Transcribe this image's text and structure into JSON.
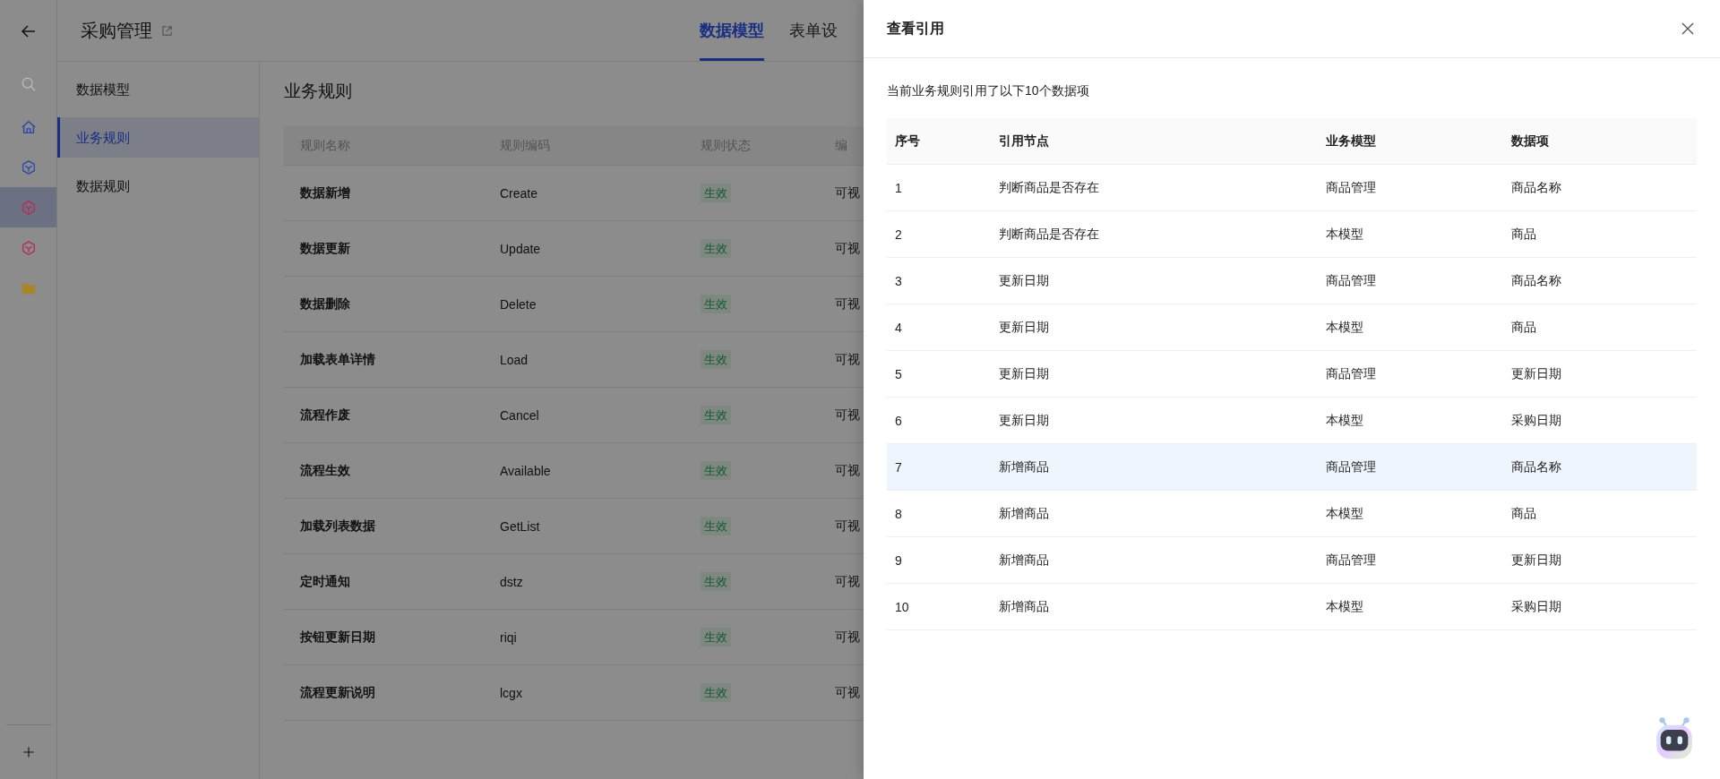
{
  "app_header": {
    "title": "采购管理",
    "tabs": [
      {
        "label": "数据模型",
        "selected": true
      },
      {
        "label": "表单设",
        "selected": false
      }
    ]
  },
  "nav_rail": [
    {
      "kind": "search",
      "selected": false
    },
    {
      "kind": "home",
      "selected": false,
      "color": "#2a48a8"
    },
    {
      "kind": "cube",
      "selected": false,
      "color": "#2a48a8"
    },
    {
      "kind": "cube",
      "selected": true,
      "color": "#b52a5e"
    },
    {
      "kind": "cube",
      "selected": false,
      "color": "#b52a5e"
    },
    {
      "kind": "folder",
      "selected": false,
      "color": "#a8852a"
    }
  ],
  "sidebar": {
    "items": [
      {
        "label": "数据模型",
        "selected": false
      },
      {
        "label": "业务规则",
        "selected": true
      },
      {
        "label": "数据规则",
        "selected": false
      }
    ]
  },
  "content": {
    "title": "业务规则",
    "table": {
      "columns": [
        "规则名称",
        "规则编码",
        "规则状态",
        "编"
      ],
      "rows": [
        {
          "name": "数据新增",
          "code": "Create",
          "status": "生效",
          "column_4": "可视"
        },
        {
          "name": "数据更新",
          "code": "Update",
          "status": "生效",
          "column_4": "可视"
        },
        {
          "name": "数据删除",
          "code": "Delete",
          "status": "生效",
          "column_4": "可视"
        },
        {
          "name": "加载表单详情",
          "code": "Load",
          "status": "生效",
          "column_4": "可视"
        },
        {
          "name": "流程作废",
          "code": "Cancel",
          "status": "生效",
          "column_4": "可视"
        },
        {
          "name": "流程生效",
          "code": "Available",
          "status": "生效",
          "column_4": "可视"
        },
        {
          "name": "加载列表数据",
          "code": "GetList",
          "status": "生效",
          "column_4": "可视"
        },
        {
          "name": "定时通知",
          "code": "dstz",
          "status": "生效",
          "column_4": "可视"
        },
        {
          "name": "按钮更新日期",
          "code": "riqi",
          "status": "生效",
          "column_4": "可视"
        },
        {
          "name": "流程更新说明",
          "code": "lcgx",
          "status": "生效",
          "column_4": "可视"
        }
      ]
    }
  },
  "drawer": {
    "title": "查看引用",
    "description": "当前业务规则引用了以下10个数据项",
    "table": {
      "columns": [
        "序号",
        "引用节点",
        "业务模型",
        "数据项"
      ],
      "rows": [
        {
          "cells": [
            "1",
            "判断商品是否存在",
            "商品管理",
            "商品名称"
          ],
          "selected": false
        },
        {
          "cells": [
            "2",
            "判断商品是否存在",
            "本模型",
            "商品"
          ],
          "selected": false
        },
        {
          "cells": [
            "3",
            "更新日期",
            "商品管理",
            "商品名称"
          ],
          "selected": false
        },
        {
          "cells": [
            "4",
            "更新日期",
            "本模型",
            "商品"
          ],
          "selected": false
        },
        {
          "cells": [
            "5",
            "更新日期",
            "商品管理",
            "更新日期"
          ],
          "selected": false
        },
        {
          "cells": [
            "6",
            "更新日期",
            "本模型",
            "采购日期"
          ],
          "selected": false
        },
        {
          "cells": [
            "7",
            "新增商品",
            "商品管理",
            "商品名称"
          ],
          "selected": true
        },
        {
          "cells": [
            "8",
            "新增商品",
            "本模型",
            "商品"
          ],
          "selected": false
        },
        {
          "cells": [
            "9",
            "新增商品",
            "商品管理",
            "更新日期"
          ],
          "selected": false
        },
        {
          "cells": [
            "10",
            "新增商品",
            "本模型",
            "采购日期"
          ],
          "selected": false
        }
      ]
    }
  }
}
